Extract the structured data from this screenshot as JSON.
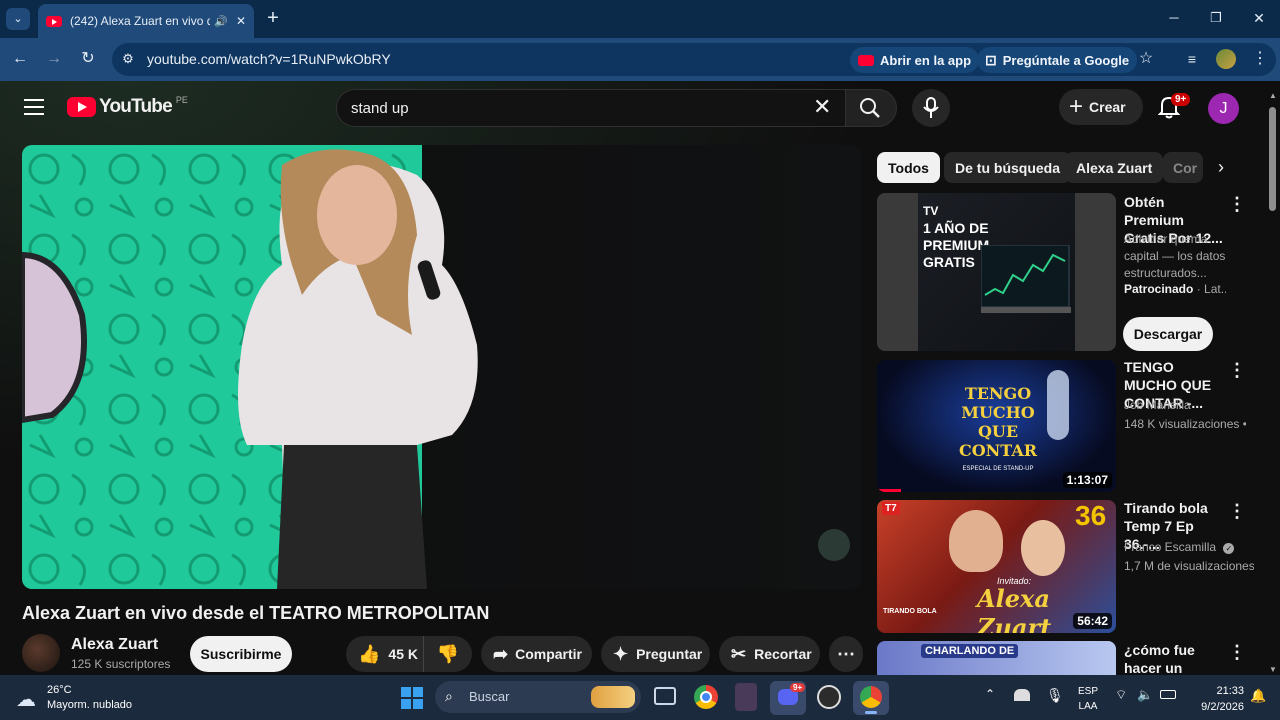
{
  "browser": {
    "tab_title": "(242) Alexa Zuart en vivo de",
    "tab_close": "✕",
    "new_tab": "+",
    "url": "youtube.com/watch?v=1RuNPwkObRY",
    "open_app_label": "Abrir en la app",
    "ask_google_label": "Pregúntale a Google",
    "window_min": "─",
    "window_max": "❐",
    "window_close": "✕"
  },
  "youtube": {
    "logo_text": "YouTube",
    "country": "PE",
    "search_value": "stand up",
    "create_label": "Crear",
    "notif_badge": "9+",
    "avatar_letter": "J",
    "chips": [
      "Todos",
      "De tu búsqueda",
      "Alexa Zuart",
      "Cor"
    ],
    "video": {
      "title": "Alexa Zuart en vivo desde el TEATRO METROPOLITAN",
      "channel": "Alexa Zuart",
      "subscribers": "125 K suscriptores",
      "subscribe_label": "Suscribirme",
      "likes": "45 K",
      "share_label": "Compartir",
      "ask_label": "Preguntar",
      "clip_label": "Recortar"
    },
    "ad": {
      "thumb_line1": "1 AÑO DE",
      "thumb_line2": "PREMIUM",
      "thumb_line3": "GRATIS",
      "title": "Obtén Premium Gratis Por 12...",
      "desc": "Adivinar quema capital — los datos estructurados...",
      "sponsored": "Patrocinado",
      "sponsored_rest": "· Lat...",
      "cta": "Descargar"
    },
    "related": [
      {
        "title": "TENGO MUCHO QUE CONTAR -...",
        "channel": "Job Mansilla",
        "meta": "148 K visualizaciones • ",
        "duration": "1:13:07",
        "thumb_text": "TENGO MUCHO QUE CONTAR",
        "thumb_sub": "ESPECIAL DE STAND-UP"
      },
      {
        "title": "Tirando bola Temp 7 Ep 36.-...",
        "channel": "Franco Escamilla",
        "meta": "1,7 M de visualizaciones",
        "duration": "56:42",
        "thumb_text": "Alexa Zuart",
        "thumb_badge": "36",
        "thumb_tag": "T7",
        "thumb_sub": "Invitado:",
        "thumb_brand": "TIRANDO BOLA"
      },
      {
        "title": "¿cómo fue hacer un musical en...",
        "thumb_text": "CHARLANDO DE"
      }
    ]
  },
  "taskbar": {
    "temp": "26°C",
    "weather": "Mayorm. nublado",
    "search_placeholder": "Buscar",
    "lang1": "ESP",
    "lang2": "LAA",
    "time": "21:33",
    "date": "9/2/2026",
    "discord_badge": "9+"
  },
  "colors": {
    "accent_red": "#ff0033",
    "subscribe_bg": "#f1f1f1",
    "avatar_purple": "#9c27b0",
    "player_green": "#1fc99a"
  }
}
